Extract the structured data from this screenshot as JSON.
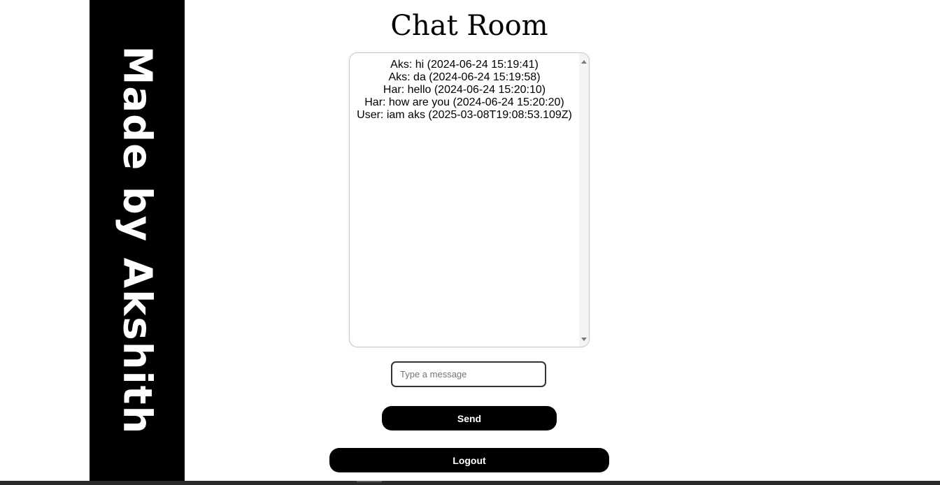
{
  "sidebar": {
    "text": "Made by Akshith"
  },
  "header": {
    "title": "Chat Room"
  },
  "chat": {
    "messages": [
      "Aks: hi (2024-06-24 15:19:41)",
      "Aks: da (2024-06-24 15:19:58)",
      "Har: hello (2024-06-24 15:20:10)",
      "Har: how are you (2024-06-24 15:20:20)",
      "User: iam aks (2025-03-08T19:08:53.109Z)"
    ]
  },
  "composer": {
    "placeholder": "Type a message",
    "value": "",
    "send_label": "Send"
  },
  "footer": {
    "logout_label": "Logout"
  },
  "colors": {
    "sidebar_bg": "#000000",
    "button_bg": "#000000",
    "button_text": "#ffffff"
  },
  "icons": {
    "scroll_up": "scroll-up-arrow-icon",
    "scroll_down": "scroll-down-arrow-icon"
  }
}
